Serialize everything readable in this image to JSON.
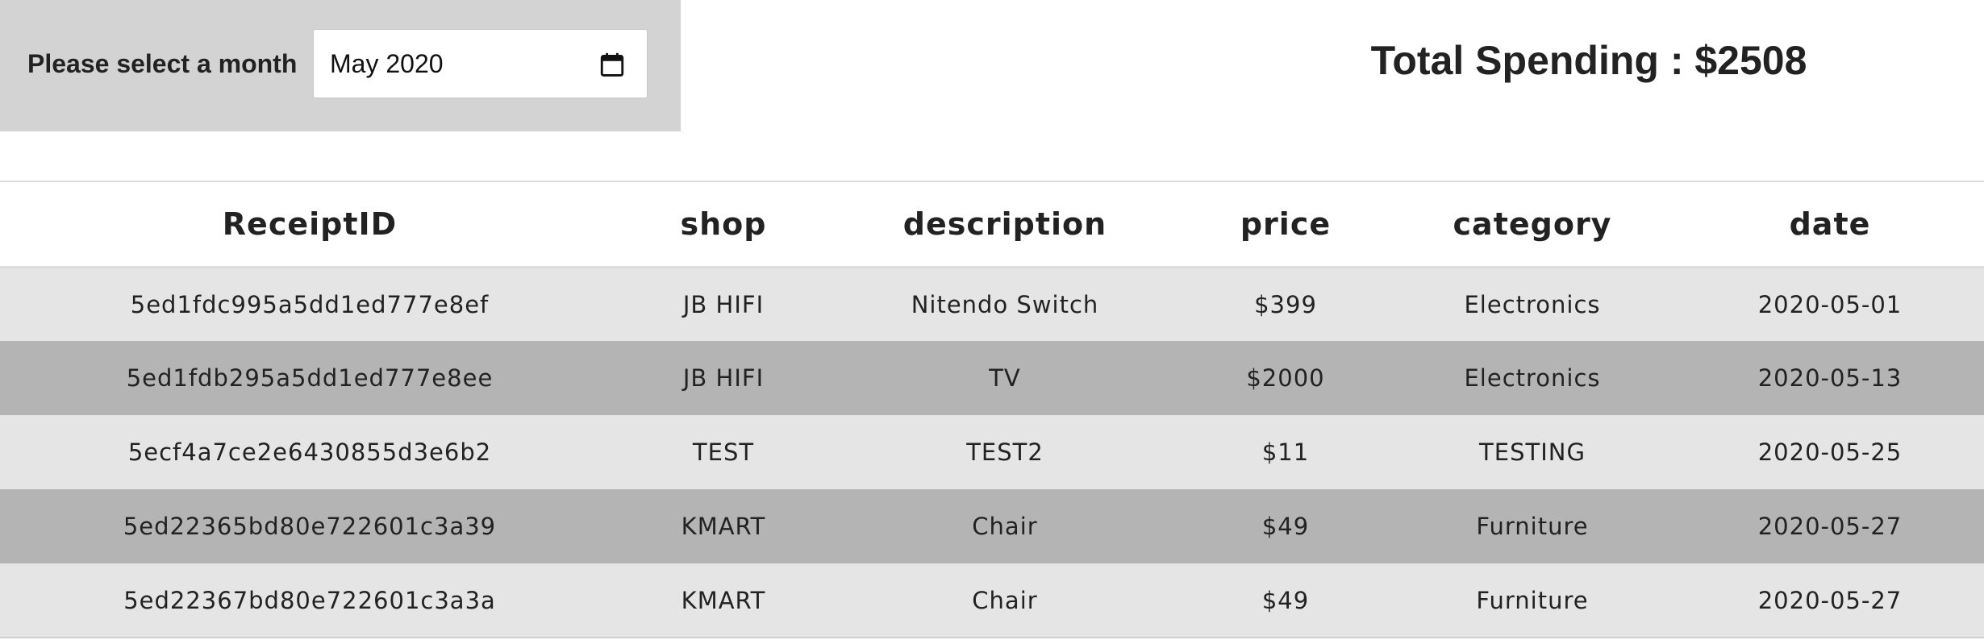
{
  "month_picker": {
    "label": "Please select a month",
    "value": "May  2020",
    "icon": "calendar-icon"
  },
  "summary": {
    "total_text": "Total Spending : $2508"
  },
  "table": {
    "columns": [
      "ReceiptID",
      "shop",
      "description",
      "price",
      "category",
      "date"
    ],
    "rows": [
      [
        "5ed1fdc995a5dd1ed777e8ef",
        "JB HIFI",
        "Nitendo Switch",
        "$399",
        "Electronics",
        "2020-05-01"
      ],
      [
        "5ed1fdb295a5dd1ed777e8ee",
        "JB HIFI",
        "TV",
        "$2000",
        "Electronics",
        "2020-05-13"
      ],
      [
        "5ecf4a7ce2e6430855d3e6b2",
        "TEST",
        "TEST2",
        "$11",
        "TESTING",
        "2020-05-25"
      ],
      [
        "5ed22365bd80e722601c3a39",
        "KMART",
        "Chair",
        "$49",
        "Furniture",
        "2020-05-27"
      ],
      [
        "5ed22367bd80e722601c3a3a",
        "KMART",
        "Chair",
        "$49",
        "Furniture",
        "2020-05-27"
      ]
    ]
  },
  "colors": {
    "panel_background": "#d3d3d3",
    "row_light": "#e5e5e5",
    "row_dark": "#b4b4b4",
    "text": "#222222"
  }
}
